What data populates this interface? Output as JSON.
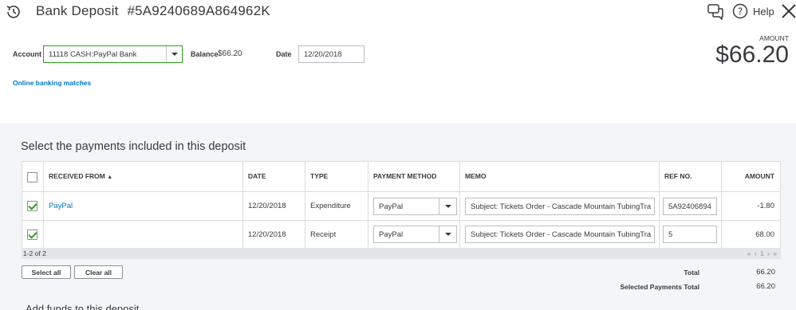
{
  "header": {
    "title": "Bank Deposit",
    "deposit_no": "#5A9240689A864962K",
    "help_label": "Help",
    "icons": {
      "recent": "recent-transactions-icon",
      "chat": "chat-icon",
      "help": "help-icon",
      "close": "close-icon"
    }
  },
  "form": {
    "account_label": "Account",
    "account_value": "11118 CASH:PayPal Bank",
    "balance_label": "Balance",
    "balance_value": "$66.20",
    "date_label": "Date",
    "date_value": "12/20/2018",
    "amount_label": "AMOUNT",
    "amount_value": "$66.20",
    "online_banking_link": "Online banking matches"
  },
  "payments": {
    "section_title": "Select the payments included in this deposit",
    "columns": {
      "received_from": "RECEIVED FROM",
      "date": "DATE",
      "type": "TYPE",
      "payment_method": "PAYMENT METHOD",
      "memo": "MEMO",
      "ref_no": "REF NO.",
      "amount": "AMOUNT"
    },
    "rows": [
      {
        "checked": true,
        "received_from": "PayPal",
        "date": "12/20/2018",
        "type": "Expenditure",
        "payment_method": "PayPal",
        "memo": "Subject: Tickets Order - Cascade Mountain TubingTra",
        "ref_no": "5A92406894",
        "amount": "-1.80"
      },
      {
        "checked": true,
        "received_from": "",
        "date": "12/20/2018",
        "type": "Receipt",
        "payment_method": "PayPal",
        "memo": "Subject: Tickets Order - Cascade Mountain TubingTra",
        "ref_no": "5",
        "amount": "68.00"
      }
    ],
    "pager_count": "1-2 of 2",
    "pager_first": "«",
    "pager_prev": "‹",
    "pager_page": "1",
    "pager_next": "›",
    "pager_last": "»",
    "select_all_label": "Select all",
    "clear_all_label": "Clear all",
    "total_label": "Total",
    "total_value": "66.20",
    "selected_total_label": "Selected Payments Total",
    "selected_total_value": "66.20"
  },
  "bottom_section_title": "Add funds to this deposit",
  "colors": {
    "accent_green": "#2ca01c",
    "link_blue": "#0077c5",
    "text": "#393a3d",
    "bg_gray": "#f4f5f8"
  }
}
